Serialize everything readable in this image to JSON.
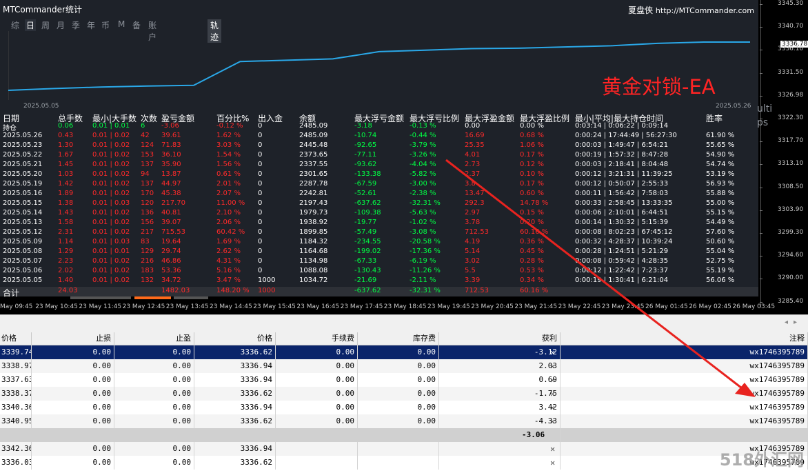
{
  "window": {
    "title": "MTCommander统计",
    "brand": "夏盘侠",
    "site": "http://MTCommander.com",
    "tabs": [
      "综",
      "日",
      "周",
      "月",
      "季",
      "年",
      "币",
      "M",
      "备",
      "账户"
    ],
    "active_tab": "日",
    "trace_tab": "轨迹"
  },
  "equity_chart": {
    "title": "黄金对锁-EA",
    "start_date": "2025.05.05",
    "end_date": "2025.05.26",
    "line_color": "#2aa8e8",
    "points": [
      1034.72,
      1088.08,
      1134.98,
      1164.68,
      1184.32,
      1899.85,
      1938.92,
      1979.73,
      2197.43,
      2242.81,
      2287.78,
      2301.65,
      2337.55,
      2373.65,
      2445.48,
      2485.09,
      2485.09
    ]
  },
  "stats": {
    "headers": [
      "日期",
      "总手数",
      "最小|大手数",
      "次数",
      "盈亏金额",
      "百分比%",
      "出入金",
      "余额",
      "最大浮亏金额",
      "最大浮亏比例",
      "最大浮盈金额",
      "最大浮盈比例",
      "最小|平均|最大持仓时间",
      "胜率"
    ],
    "holding": {
      "date": "持仓",
      "lots": "0.06",
      "minmax": "0.01 | 0.01",
      "count": "6",
      "pnl": "-3.06",
      "pct": "-0.12 %",
      "io": "0",
      "balance": "2485.09",
      "maxdd": "-3.18",
      "maxdd_pct": "-0.13 %",
      "maxfp": "0.00",
      "maxfp_pct": "0.00 %",
      "time": "0:03:14 | 0:06:22 | 0:09:14",
      "win": ""
    },
    "rows": [
      {
        "date": "2025.05.26",
        "lots": "0.43",
        "minmax": "0.01 | 0.02",
        "count": "42",
        "pnl": "39.61",
        "pct": "1.62 %",
        "io": "0",
        "balance": "2485.09",
        "maxdd": "-10.74",
        "maxdd_pct": "-0.44 %",
        "maxfp": "16.69",
        "maxfp_pct": "0.68 %",
        "time": "0:00:24 | 17:44:49 | 56:27:30",
        "win": "61.90 %"
      },
      {
        "date": "2025.05.23",
        "lots": "1.30",
        "minmax": "0.01 | 0.02",
        "count": "124",
        "pnl": "71.83",
        "pct": "3.03 %",
        "io": "0",
        "balance": "2445.48",
        "maxdd": "-92.65",
        "maxdd_pct": "-3.79 %",
        "maxfp": "25.35",
        "maxfp_pct": "1.06 %",
        "time": "0:00:03 | 1:49:47 | 6:54:21",
        "win": "55.65 %"
      },
      {
        "date": "2025.05.22",
        "lots": "1.67",
        "minmax": "0.01 | 0.02",
        "count": "153",
        "pnl": "36.10",
        "pct": "1.54 %",
        "io": "0",
        "balance": "2373.65",
        "maxdd": "-77.11",
        "maxdd_pct": "-3.26 %",
        "maxfp": "4.01",
        "maxfp_pct": "0.17 %",
        "time": "0:00:19 | 1:57:32 | 8:47:28",
        "win": "54.90 %"
      },
      {
        "date": "2025.05.21",
        "lots": "1.45",
        "minmax": "0.01 | 0.02",
        "count": "137",
        "pnl": "35.90",
        "pct": "1.56 %",
        "io": "0",
        "balance": "2337.55",
        "maxdd": "-93.62",
        "maxdd_pct": "-4.04 %",
        "maxfp": "2.73",
        "maxfp_pct": "0.12 %",
        "time": "0:00:03 | 2:18:41 | 8:04:48",
        "win": "54.74 %"
      },
      {
        "date": "2025.05.20",
        "lots": "1.03",
        "minmax": "0.01 | 0.02",
        "count": "94",
        "pnl": "13.87",
        "pct": "0.61 %",
        "io": "0",
        "balance": "2301.65",
        "maxdd": "-133.38",
        "maxdd_pct": "-5.82 %",
        "maxfp": "2.37",
        "maxfp_pct": "0.10 %",
        "time": "0:00:12 | 3:21:31 | 11:39:25",
        "win": "53.19 %"
      },
      {
        "date": "2025.05.19",
        "lots": "1.42",
        "minmax": "0.01 | 0.02",
        "count": "137",
        "pnl": "44.97",
        "pct": "2.01 %",
        "io": "0",
        "balance": "2287.78",
        "maxdd": "-67.59",
        "maxdd_pct": "-3.00 %",
        "maxfp": "3.8",
        "maxfp_pct": "0.17 %",
        "time": "0:00:12 | 0:50:07 | 2:55:33",
        "win": "56.93 %"
      },
      {
        "date": "2025.05.16",
        "lots": "1.89",
        "minmax": "0.01 | 0.02",
        "count": "170",
        "pnl": "45.38",
        "pct": "2.07 %",
        "io": "0",
        "balance": "2242.81",
        "maxdd": "-52.61",
        "maxdd_pct": "-2.38 %",
        "maxfp": "13.47",
        "maxfp_pct": "0.60 %",
        "time": "0:00:11 | 1:56:42 | 7:58:03",
        "win": "55.88 %"
      },
      {
        "date": "2025.05.15",
        "lots": "1.38",
        "minmax": "0.01 | 0.03",
        "count": "120",
        "pnl": "217.70",
        "pct": "11.00 %",
        "io": "0",
        "balance": "2197.43",
        "maxdd": "-637.62",
        "maxdd_pct": "-32.31 %",
        "maxfp": "292.3",
        "maxfp_pct": "14.78 %",
        "time": "0:00:33 | 2:58:45 | 13:33:35",
        "win": "55.00 %"
      },
      {
        "date": "2025.05.14",
        "lots": "1.43",
        "minmax": "0.01 | 0.02",
        "count": "136",
        "pnl": "40.81",
        "pct": "2.10 %",
        "io": "0",
        "balance": "1979.73",
        "maxdd": "-109.38",
        "maxdd_pct": "-5.63 %",
        "maxfp": "2.97",
        "maxfp_pct": "0.15 %",
        "time": "0:00:06 | 2:10:01 | 6:44:51",
        "win": "55.15 %"
      },
      {
        "date": "2025.05.13",
        "lots": "1.58",
        "minmax": "0.01 | 0.02",
        "count": "156",
        "pnl": "39.07",
        "pct": "2.06 %",
        "io": "0",
        "balance": "1938.92",
        "maxdd": "-19.77",
        "maxdd_pct": "-1.02 %",
        "maxfp": "3.78",
        "maxfp_pct": "0.20 %",
        "time": "0:00:14 | 1:30:32 | 5:15:39",
        "win": "54.49 %"
      },
      {
        "date": "2025.05.12",
        "lots": "2.31",
        "minmax": "0.01 | 0.02",
        "count": "217",
        "pnl": "715.53",
        "pct": "60.42 %",
        "io": "0",
        "balance": "1899.85",
        "maxdd": "-57.49",
        "maxdd_pct": "-3.08 %",
        "maxfp": "712.53",
        "maxfp_pct": "60.16 %",
        "time": "0:00:08 | 8:02:23 | 67:45:12",
        "win": "57.60 %"
      },
      {
        "date": "2025.05.09",
        "lots": "1.14",
        "minmax": "0.01 | 0.03",
        "count": "83",
        "pnl": "19.64",
        "pct": "1.69 %",
        "io": "0",
        "balance": "1184.32",
        "maxdd": "-234.55",
        "maxdd_pct": "-20.58 %",
        "maxfp": "4.19",
        "maxfp_pct": "0.36 %",
        "time": "0:00:32 | 4:28:37 | 10:39:24",
        "win": "50.60 %"
      },
      {
        "date": "2025.05.08",
        "lots": "1.29",
        "minmax": "0.01 | 0.01",
        "count": "129",
        "pnl": "29.74",
        "pct": "2.62 %",
        "io": "0",
        "balance": "1164.68",
        "maxdd": "-199.02",
        "maxdd_pct": "-17.36 %",
        "maxfp": "5.14",
        "maxfp_pct": "0.45 %",
        "time": "0:00:28 | 1:24:51 | 5:21:29",
        "win": "55.04 %"
      },
      {
        "date": "2025.05.07",
        "lots": "2.23",
        "minmax": "0.01 | 0.02",
        "count": "216",
        "pnl": "46.86",
        "pct": "4.31 %",
        "io": "0",
        "balance": "1134.98",
        "maxdd": "-67.33",
        "maxdd_pct": "-6.19 %",
        "maxfp": "3.02",
        "maxfp_pct": "0.28 %",
        "time": "0:00:08 | 0:59:42 | 4:28:35",
        "win": "52.75 %"
      },
      {
        "date": "2025.05.06",
        "lots": "2.02",
        "minmax": "0.01 | 0.02",
        "count": "183",
        "pnl": "53.36",
        "pct": "5.16 %",
        "io": "0",
        "balance": "1088.08",
        "maxdd": "-130.43",
        "maxdd_pct": "-11.26 %",
        "maxfp": "5.5",
        "maxfp_pct": "0.53 %",
        "time": "0:00:12 | 1:22:42 | 7:23:37",
        "win": "55.19 %"
      },
      {
        "date": "2025.05.05",
        "lots": "1.40",
        "minmax": "0.01 | 0.02",
        "count": "132",
        "pnl": "34.72",
        "pct": "3.47 %",
        "io": "1000",
        "balance": "1034.72",
        "maxdd": "-21.69",
        "maxdd_pct": "-2.11 %",
        "maxfp": "3.39",
        "maxfp_pct": "0.34 %",
        "time": "0:00:19 | 1:30:41 | 6:21:04",
        "win": "56.06 %"
      }
    ],
    "total": {
      "date": "合计",
      "lots": "24.03",
      "pnl": "1482.03",
      "pct": "148.20 %",
      "io": "1000",
      "maxdd": "-637.62",
      "maxdd_pct": "-32.31 %",
      "maxfp": "712.53",
      "maxfp_pct": "60.16 %"
    }
  },
  "price_axis": {
    "ticks": [
      "3345.30",
      "3340.70",
      "3336.10",
      "3331.50",
      "3326.98",
      "3322.30",
      "3317.70",
      "3313.10",
      "3308.50",
      "3303.90",
      "3299.30",
      "3294.60",
      "3290.00",
      "3285.40"
    ],
    "current": "3336.78"
  },
  "time_axis": [
    "May 09:45",
    "23 May 10:45",
    "23 May 11:45",
    "23 May 12:45",
    "23 May 13:45",
    "23 May 14:45",
    "23 May 15:45",
    "23 May 16:45",
    "23 May 17:45",
    "23 May 18:45",
    "23 May 19:45",
    "23 May 20:45",
    "23 May 21:45",
    "23 May 22:45",
    "23 May 23:45",
    "26 May 01:45",
    "26 May 02:45",
    "26 May 03:45"
  ],
  "side_labels": [
    "ulti",
    "ps"
  ],
  "orders": {
    "headers": [
      "价格",
      "止损",
      "止盈",
      "价格",
      "手续费",
      "库存费",
      "获利",
      "注释"
    ],
    "rows": [
      {
        "price": "3339.74",
        "sl": "0.00",
        "tp": "0.00",
        "cur": "3336.62",
        "comm": "0.00",
        "swap": "0.00",
        "profit": "-3.12",
        "note": "wx1746395789",
        "selected": true
      },
      {
        "price": "3338.97",
        "sl": "0.00",
        "tp": "0.00",
        "cur": "3336.94",
        "comm": "0.00",
        "swap": "0.00",
        "profit": "2.03",
        "note": "wx1746395789"
      },
      {
        "price": "3337.63",
        "sl": "0.00",
        "tp": "0.00",
        "cur": "3336.94",
        "comm": "0.00",
        "swap": "0.00",
        "profit": "0.69",
        "note": "wx1746395789"
      },
      {
        "price": "3338.37",
        "sl": "0.00",
        "tp": "0.00",
        "cur": "3336.62",
        "comm": "0.00",
        "swap": "0.00",
        "profit": "-1.75",
        "note": "wx1746395789"
      },
      {
        "price": "3340.36",
        "sl": "0.00",
        "tp": "0.00",
        "cur": "3336.94",
        "comm": "0.00",
        "swap": "0.00",
        "profit": "3.42",
        "note": "wx1746395789"
      },
      {
        "price": "3340.95",
        "sl": "0.00",
        "tp": "0.00",
        "cur": "3336.62",
        "comm": "0.00",
        "swap": "0.00",
        "profit": "-4.33",
        "note": "wx1746395789"
      }
    ],
    "summary_profit": "-3.06",
    "pending": [
      {
        "price": "3342.36",
        "sl": "0.00",
        "tp": "0.00",
        "cur": "3336.94",
        "note": "wx1746395789"
      },
      {
        "price": "3336.03",
        "sl": "0.00",
        "tp": "0.00",
        "cur": "3336.62",
        "note": "wx1746395789"
      }
    ]
  },
  "watermark": "518外汇网"
}
